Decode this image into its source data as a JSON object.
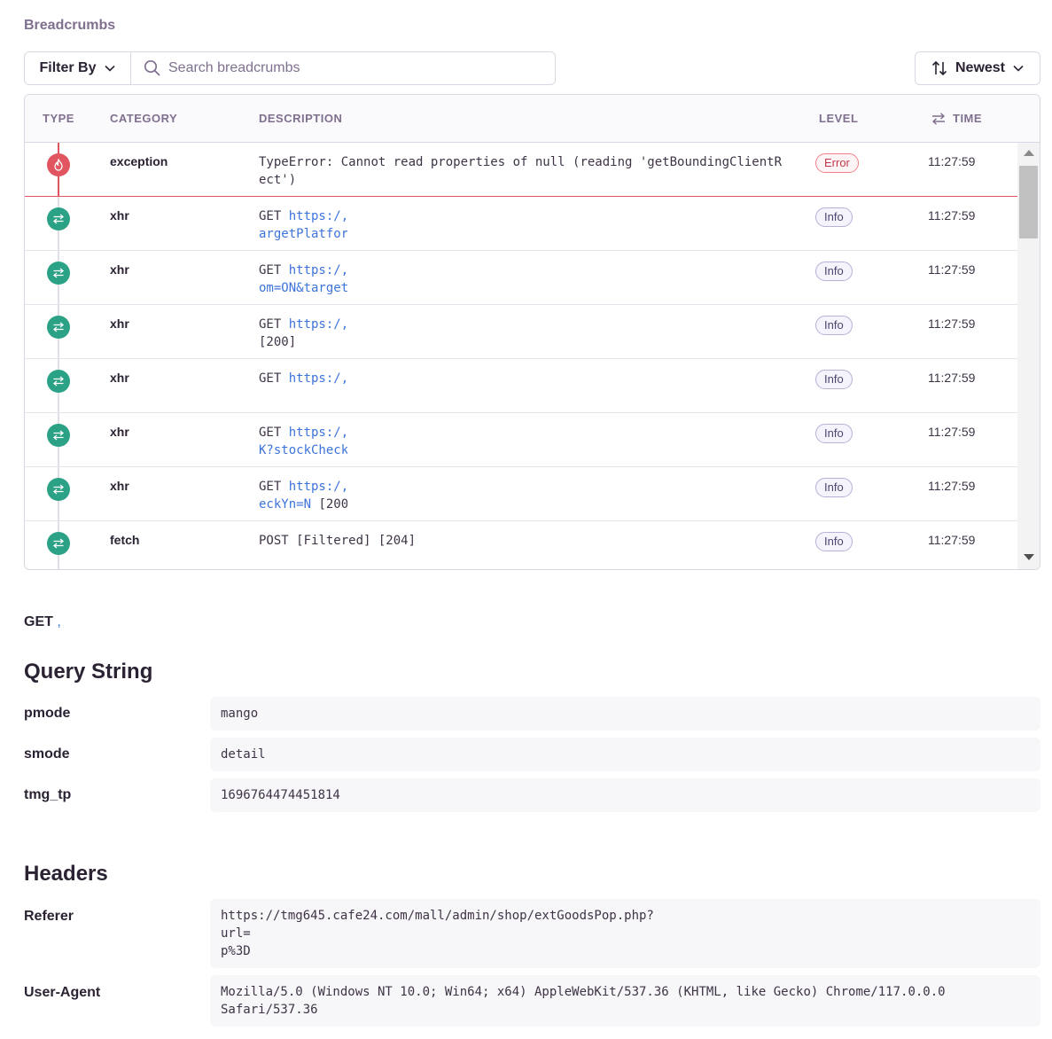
{
  "section_title": "Breadcrumbs",
  "filter": {
    "label": "Filter By",
    "placeholder": "Search breadcrumbs"
  },
  "sort": {
    "label": "Newest"
  },
  "columns": {
    "type": "TYPE",
    "category": "CATEGORY",
    "description": "DESCRIPTION",
    "level": "LEVEL",
    "time": "TIME"
  },
  "rows": [
    {
      "category": "exception",
      "level": "Error",
      "time": "11:27:59",
      "icon": "fire-icon",
      "desc_prefix": "TypeError:",
      "desc_text": " Cannot read properties of null (reading 'getBoundingClientRect')",
      "url_l1": "",
      "url_l2": "",
      "suffix_l2": ""
    },
    {
      "category": "xhr",
      "level": "Info",
      "time": "11:27:59",
      "icon": "swap-icon",
      "desc_prefix": "GET ",
      "desc_text": "",
      "url_l1": "https:/,",
      "url_l2": "argetPlatfor",
      "suffix_l2": ""
    },
    {
      "category": "xhr",
      "level": "Info",
      "time": "11:27:59",
      "icon": "swap-icon",
      "desc_prefix": "GET ",
      "desc_text": "",
      "url_l1": "https:/,",
      "url_l2": "om=ON&target",
      "suffix_l2": ""
    },
    {
      "category": "xhr",
      "level": "Info",
      "time": "11:27:59",
      "icon": "swap-icon",
      "desc_prefix": "GET ",
      "desc_text": "",
      "url_l1": "https:/,",
      "url_l2": "",
      "suffix_l2": "[200]"
    },
    {
      "category": "xhr",
      "level": "Info",
      "time": "11:27:59",
      "icon": "swap-icon",
      "desc_prefix": "GET ",
      "desc_text": "",
      "url_l1": "https:/,",
      "url_l2": "",
      "suffix_l2": ""
    },
    {
      "category": "xhr",
      "level": "Info",
      "time": "11:27:59",
      "icon": "swap-icon",
      "desc_prefix": "GET ",
      "desc_text": "",
      "url_l1": "https:/,",
      "url_l2": "K?stockCheck",
      "suffix_l2": ""
    },
    {
      "category": "xhr",
      "level": "Info",
      "time": "11:27:59",
      "icon": "swap-icon",
      "desc_prefix": "GET ",
      "desc_text": "",
      "url_l1": "https:/,",
      "url_l2": "eckYn=N",
      "suffix_l2": " [200"
    },
    {
      "category": "fetch",
      "level": "Info",
      "time": "11:27:59",
      "icon": "swap-icon",
      "desc_prefix": "POST ",
      "desc_text": "[Filtered] [204]",
      "url_l1": "",
      "url_l2": "",
      "suffix_l2": ""
    }
  ],
  "detail": {
    "method": "GET",
    "url_sep": ",",
    "query_title": "Query String",
    "query": [
      {
        "key": "pmode",
        "value": "mango"
      },
      {
        "key": "smode",
        "value": "detail"
      },
      {
        "key": "tmg_tp",
        "value": "1696764474451814"
      }
    ],
    "headers_title": "Headers",
    "headers": [
      {
        "key": "Referer",
        "value": "https://tmg645.cafe24.com/mall/admin/shop/extGoodsPop.php?\nurl=\np%3D"
      },
      {
        "key": "User-Agent",
        "value": "Mozilla/5.0 (Windows NT 10.0; Win64; x64) AppleWebKit/537.36 (KHTML, like Gecko) Chrome/117.0.0.0\nSafari/537.36"
      }
    ]
  },
  "colors": {
    "error": "#e0555f",
    "xhr": "#2ba185",
    "link": "#3d74db",
    "muted": "#80708f"
  }
}
